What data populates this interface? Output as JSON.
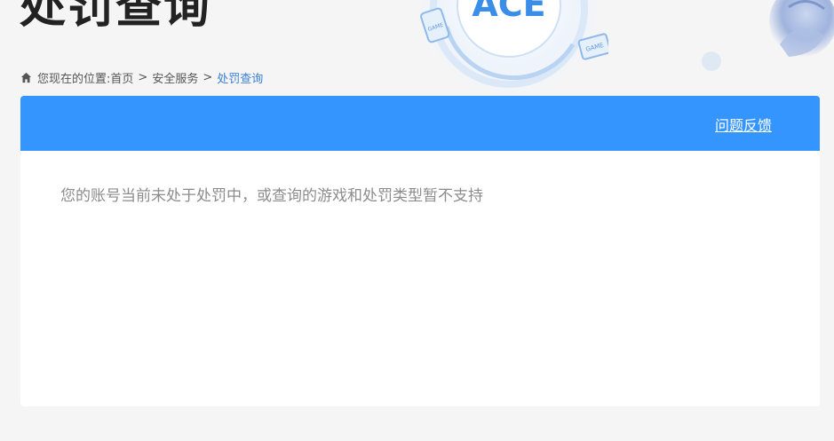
{
  "page": {
    "title": "处罚查询"
  },
  "breadcrumb": {
    "prefix": "您现在的位置:",
    "items": [
      "首页",
      "安全服务"
    ],
    "current": "处罚查询",
    "separator": ">"
  },
  "decoration": {
    "logo_text": "ACE",
    "badge_text": "GAME"
  },
  "card": {
    "feedback_label": "问题反馈",
    "message": "您的账号当前未处于处罚中，或查询的游戏和处罚类型暂不支持"
  },
  "colors": {
    "header_blue": "#3595ff",
    "breadcrumb_current": "#3a7fd0",
    "background": "#f5f5f6"
  },
  "icons": {
    "breadcrumb_home": "home-icon"
  }
}
